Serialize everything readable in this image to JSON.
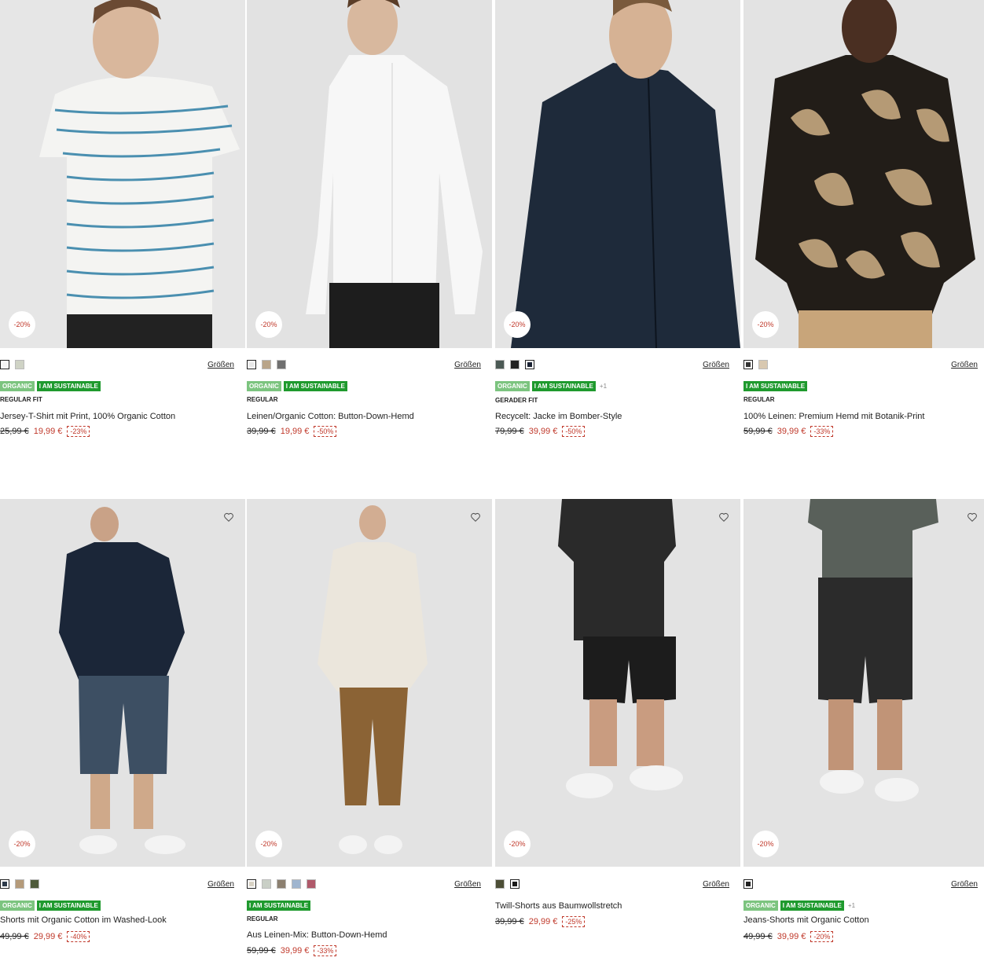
{
  "colors": {
    "sale": "#c0392b",
    "organic": "#7cc47f",
    "sustainable": "#1f9a2e",
    "image_bg": "#e3e3e3"
  },
  "products": [
    {
      "badge": "-20%",
      "sizes": "Größen",
      "tags": [
        "ORGANIC",
        "I AM SUSTAINABLE"
      ],
      "more": "",
      "fit": "REGULAR FIT",
      "name": "Jersey-T-Shirt mit Print, 100% Organic Cotton",
      "old": "25,99 €",
      "new": "19,99 €",
      "disc": "-23%",
      "swatches": [
        "#f4f4f4",
        "#cfd3c5"
      ],
      "heart": false
    },
    {
      "badge": "-20%",
      "sizes": "Größen",
      "tags": [
        "ORGANIC",
        "I AM SUSTAINABLE"
      ],
      "more": "",
      "fit": "REGULAR",
      "name": "Leinen/Organic Cotton: Button-Down-Hemd",
      "old": "39,99 €",
      "new": "19,99 €",
      "disc": "-50%",
      "swatches": [
        "#e8e8e8",
        "#b9a58a",
        "#6f6f6f"
      ],
      "heart": false
    },
    {
      "badge": "-20%",
      "sizes": "Größen",
      "tags": [
        "ORGANIC",
        "I AM SUSTAINABLE"
      ],
      "more": "+1",
      "fit": "GERADER FIT",
      "name": "Recycelt: Jacke im Bomber-Style",
      "old": "79,99 €",
      "new": "39,99 €",
      "disc": "-50%",
      "swatches": [
        "#4c5a55",
        "#222222",
        "#1b2233"
      ],
      "heart": false
    },
    {
      "badge": "-20%",
      "sizes": "Größen",
      "tags": [
        "I AM SUSTAINABLE"
      ],
      "more": "",
      "fit": "REGULAR",
      "name": "100% Leinen: Premium Hemd mit Botanik-Print",
      "old": "59,99 €",
      "new": "39,99 €",
      "disc": "-33%",
      "swatches": [
        "#333333",
        "#d8c8b0"
      ],
      "heart": false
    },
    {
      "badge": "-20%",
      "sizes": "Größen",
      "tags": [
        "ORGANIC",
        "I AM SUSTAINABLE"
      ],
      "more": "",
      "fit": "",
      "name": "Shorts mit Organic Cotton im Washed-Look",
      "old": "49,99 €",
      "new": "29,99 €",
      "disc": "-40%",
      "swatches": [
        "#2d3a4a",
        "#b59b7a",
        "#4e5a3a"
      ],
      "heart": true
    },
    {
      "badge": "-20%",
      "sizes": "Größen",
      "tags": [
        "I AM SUSTAINABLE"
      ],
      "more": "",
      "fit": "REGULAR",
      "name": "Aus Leinen-Mix: Button-Down-Hemd",
      "old": "59,99 €",
      "new": "39,99 €",
      "disc": "-33%",
      "swatches": [
        "#d8d2c4",
        "#c9cfc6",
        "#8c8070",
        "#9fb5cf",
        "#b0596a"
      ],
      "heart": true
    },
    {
      "badge": "-20%",
      "sizes": "Größen",
      "tags": [],
      "more": "",
      "fit": "",
      "name": "Twill-Shorts aus Baumwollstretch",
      "old": "39,99 €",
      "new": "29,99 €",
      "disc": "-25%",
      "swatches": [
        "#4c4e36",
        "#1a1a1a"
      ],
      "heart": true
    },
    {
      "badge": "-20%",
      "sizes": "Größen",
      "tags": [
        "ORGANIC",
        "I AM SUSTAINABLE"
      ],
      "more": "+1",
      "fit": "",
      "name": "Jeans-Shorts mit Organic Cotton",
      "old": "49,99 €",
      "new": "39,99 €",
      "disc": "-20%",
      "swatches": [
        "#222222"
      ],
      "heart": true
    }
  ]
}
